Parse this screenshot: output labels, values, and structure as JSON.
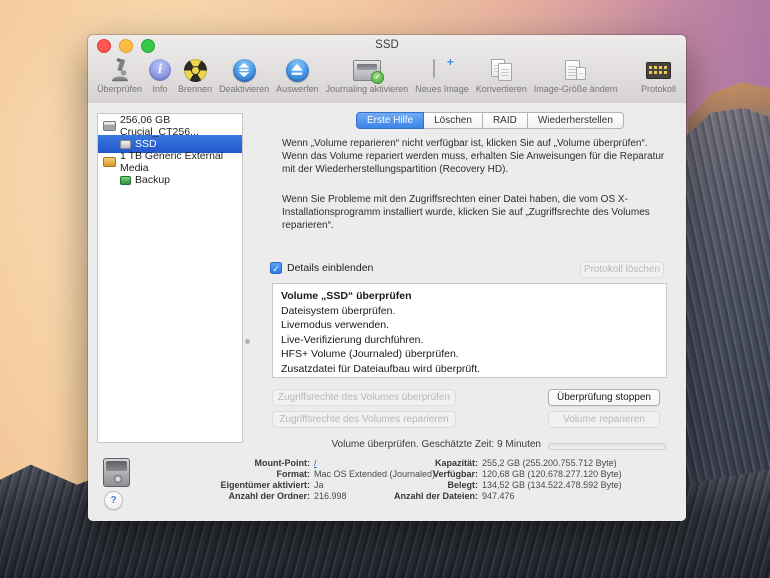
{
  "window": {
    "title": "SSD"
  },
  "toolbar": {
    "items": [
      {
        "label": "Überprüfen",
        "icon": "microscope-icon"
      },
      {
        "label": "Info",
        "icon": "info-icon"
      },
      {
        "label": "Brennen",
        "icon": "burn-icon"
      },
      {
        "label": "Deaktivieren",
        "icon": "unmount-icon"
      },
      {
        "label": "Auswerfen",
        "icon": "eject-icon"
      },
      {
        "label": "Journaling aktivieren",
        "icon": "enable-journaling-icon"
      },
      {
        "label": "Neues Image",
        "icon": "new-image-icon"
      },
      {
        "label": "Konvertieren",
        "icon": "convert-icon"
      },
      {
        "label": "Image-Größe ändern",
        "icon": "resize-image-icon"
      },
      {
        "label": "Protokoll",
        "icon": "log-icon"
      }
    ]
  },
  "sidebar": {
    "items": [
      {
        "label": "256,06 GB Crucial_CT256...",
        "icon": "internal-disk-icon",
        "selected": false
      },
      {
        "label": "SSD",
        "icon": "volume-icon",
        "selected": true
      },
      {
        "label": "1 TB Generic External Media",
        "icon": "external-disk-icon",
        "selected": false
      },
      {
        "label": "Backup",
        "icon": "backup-volume-icon",
        "selected": false
      }
    ]
  },
  "tabs": [
    {
      "label": "Erste Hilfe",
      "selected": true
    },
    {
      "label": "Löschen",
      "selected": false
    },
    {
      "label": "RAID",
      "selected": false
    },
    {
      "label": "Wiederherstellen",
      "selected": false
    }
  ],
  "first_aid": {
    "paragraph1": "Wenn „Volume reparieren“ nicht verfügbar ist, klicken Sie auf „Volume überprüfen“. Wenn das Volume repariert werden muss, erhalten Sie Anweisungen für die Reparatur mit der Wiederherstellungspartition (Recovery HD).",
    "paragraph2": "Wenn Sie Probleme mit den Zugriffsrechten einer Datei haben, die vom OS X-Installationsprogramm installiert wurde, klicken Sie auf „Zugriffsrechte des Volumes reparieren“.",
    "details_checkbox_label": "Details einblenden",
    "details_checked": true,
    "clear_log_button": "Protokoll löschen",
    "log_lines": [
      "Volume „SSD“ überprüfen",
      "Dateisystem überprüfen.",
      "Livemodus verwenden.",
      "Live-Verifizierung durchführen.",
      "HFS+ Volume (Journaled) überprüfen.",
      "Zusatzdatei für Dateiaufbau wird überprüft."
    ],
    "verify_permissions_button": "Zugriffsrechte des Volumes überprüfen",
    "repair_permissions_button": "Zugriffsrechte des Volumes reparieren",
    "stop_button": "Überprüfung stoppen",
    "repair_volume_button": "Volume reparieren",
    "status_text": "Volume überprüfen. Geschätzte Zeit: 9 Minuten"
  },
  "footer": {
    "left": [
      {
        "label": "Mount-Point:",
        "value": "/"
      },
      {
        "label": "Format:",
        "value": "Mac OS Extended (Journaled)"
      },
      {
        "label": "Eigentümer aktiviert:",
        "value": "Ja"
      },
      {
        "label": "Anzahl der Ordner:",
        "value": "216.998"
      }
    ],
    "right": [
      {
        "label": "Kapazität:",
        "value": "255,2 GB (255.200.755.712 Byte)"
      },
      {
        "label": "Verfügbar:",
        "value": "120,68 GB (120.678.277.120 Byte)"
      },
      {
        "label": "Belegt:",
        "value": "134,52 GB (134.522.478.592 Byte)"
      },
      {
        "label": "Anzahl der Dateien:",
        "value": "947.476"
      }
    ],
    "help_label": "?"
  },
  "colors": {
    "selection_blue": "#2a65d9",
    "tab_selected_blue": "#3c84e8",
    "link_blue": "#2662d9"
  }
}
